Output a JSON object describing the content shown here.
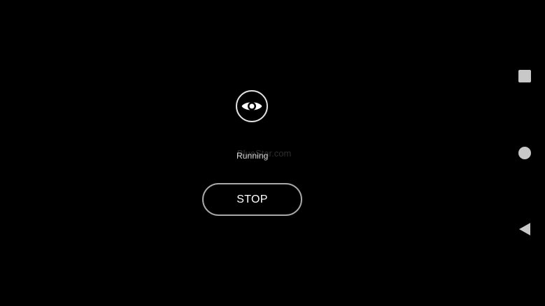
{
  "app": {
    "status_icon": "eye-icon",
    "watermark": "BlueStar.com",
    "status_text": "Running",
    "stop_label": "STOP"
  },
  "nav_bar": {
    "recents_icon": "square-icon",
    "home_icon": "circle-icon",
    "back_icon": "triangle-back-icon"
  },
  "colors": {
    "background": "#000000",
    "button_border": "#a8a8a8",
    "text": "#ffffff",
    "nav_icon": "#c8c8c8"
  }
}
